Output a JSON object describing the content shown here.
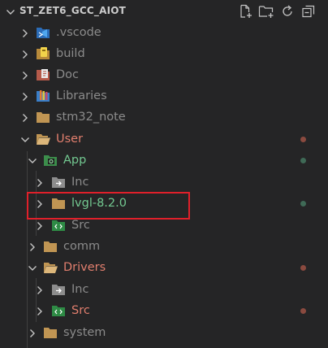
{
  "explorer": {
    "section_title": "ST_ZET6_GCC_AIOT",
    "actions": [
      "new-file-icon",
      "new-folder-icon",
      "refresh-icon",
      "collapse-all-icon"
    ]
  },
  "colors": {
    "background": "#252526",
    "text_default": "#cccccc",
    "text_dimmed": "#8b8b8b",
    "text_modified": "#e27f6e",
    "text_added": "#73c991",
    "dot_modified": "#8a4a3f",
    "dot_untracked": "#3f6a56",
    "highlight_border": "#e0202a"
  },
  "tree": [
    {
      "label": ".vscode",
      "icon": "vscode-folder-icon",
      "expanded": false,
      "status": "dimmed"
    },
    {
      "label": "build",
      "icon": "build-folder-icon",
      "expanded": false,
      "status": "dimmed"
    },
    {
      "label": "Doc",
      "icon": "doc-folder-icon",
      "expanded": false,
      "status": "dimmed"
    },
    {
      "label": "Libraries",
      "icon": "libraries-folder-icon",
      "expanded": false,
      "status": "dimmed"
    },
    {
      "label": "stm32_note",
      "icon": "folder-icon",
      "expanded": false,
      "status": "dimmed"
    },
    {
      "label": "User",
      "icon": "folder-open-icon",
      "expanded": true,
      "status": "modified"
    },
    {
      "label": "App",
      "icon": "app-folder-icon",
      "expanded": true,
      "status": "added"
    },
    {
      "label": "Inc",
      "icon": "include-folder-icon",
      "expanded": false,
      "status": "dimmed"
    },
    {
      "label": "lvgl-8.2.0",
      "icon": "folder-icon",
      "expanded": false,
      "status": "added"
    },
    {
      "label": "Src",
      "icon": "source-folder-icon",
      "expanded": false,
      "status": "dimmed"
    },
    {
      "label": "comm",
      "icon": "folder-icon",
      "expanded": false,
      "status": "dimmed"
    },
    {
      "label": "Drivers",
      "icon": "folder-open-icon",
      "expanded": true,
      "status": "modified"
    },
    {
      "label": "Inc",
      "icon": "include-folder-icon",
      "expanded": false,
      "status": "dimmed"
    },
    {
      "label": "Src",
      "icon": "source-folder-icon",
      "expanded": false,
      "status": "modified"
    },
    {
      "label": "system",
      "icon": "folder-icon",
      "expanded": false,
      "status": "dimmed"
    }
  ]
}
